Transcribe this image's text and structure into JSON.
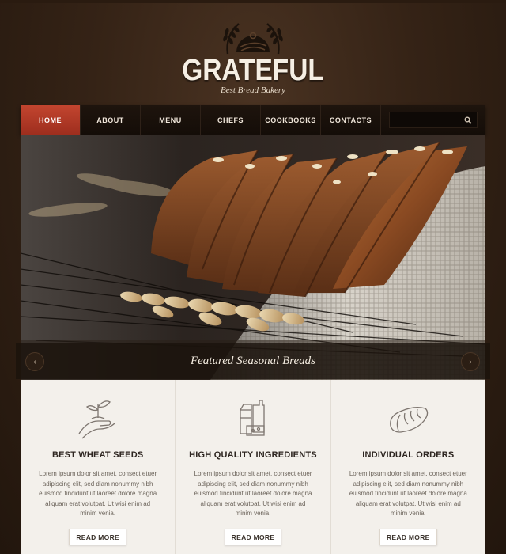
{
  "brand": {
    "name": "GRATEFUL",
    "tagline": "Best Bread Bakery"
  },
  "nav": {
    "items": [
      {
        "label": "HOME",
        "active": true
      },
      {
        "label": "ABOUT"
      },
      {
        "label": "MENU"
      },
      {
        "label": "CHEFS"
      },
      {
        "label": "COOKBOOKS"
      },
      {
        "label": "CONTACTS"
      }
    ],
    "search": {
      "placeholder": "",
      "icon": "search-icon"
    }
  },
  "slider": {
    "caption": "Featured Seasonal Breads",
    "prev_icon": "chevron-left-icon",
    "next_icon": "chevron-right-icon"
  },
  "features": [
    {
      "icon": "hand-sprout-icon",
      "title": "BEST WHEAT SEEDS",
      "text": "Lorem ipsum dolor sit amet, consect etuer adipiscing elit, sed diam nonummy nibh euismod tincidunt ut laoreet dolore magna aliquam erat volutpat. Ut wisi enim ad minim venia.",
      "button": "READ MORE"
    },
    {
      "icon": "ingredients-icon",
      "title": "HIGH QUALITY INGREDIENTS",
      "text": "Lorem ipsum dolor sit amet, consect etuer adipiscing elit, sed diam nonummy nibh euismod tincidunt ut laoreet dolore magna aliquam erat volutpat. Ut wisi enim ad minim venia.",
      "button": "READ MORE"
    },
    {
      "icon": "bread-loaf-icon",
      "title": "INDIVIDUAL ORDERS",
      "text": "Lorem ipsum dolor sit amet, consect etuer adipiscing elit, sed diam nonummy nibh euismod tincidunt ut laoreet dolore magna aliquam erat volutpat. Ut wisi enim ad minim venia.",
      "button": "READ MORE"
    }
  ],
  "colors": {
    "accent": "#b33a27",
    "nav_bg": "#1a110b",
    "page_bg": "#3a2718",
    "panel_bg": "#f3f0eb"
  }
}
